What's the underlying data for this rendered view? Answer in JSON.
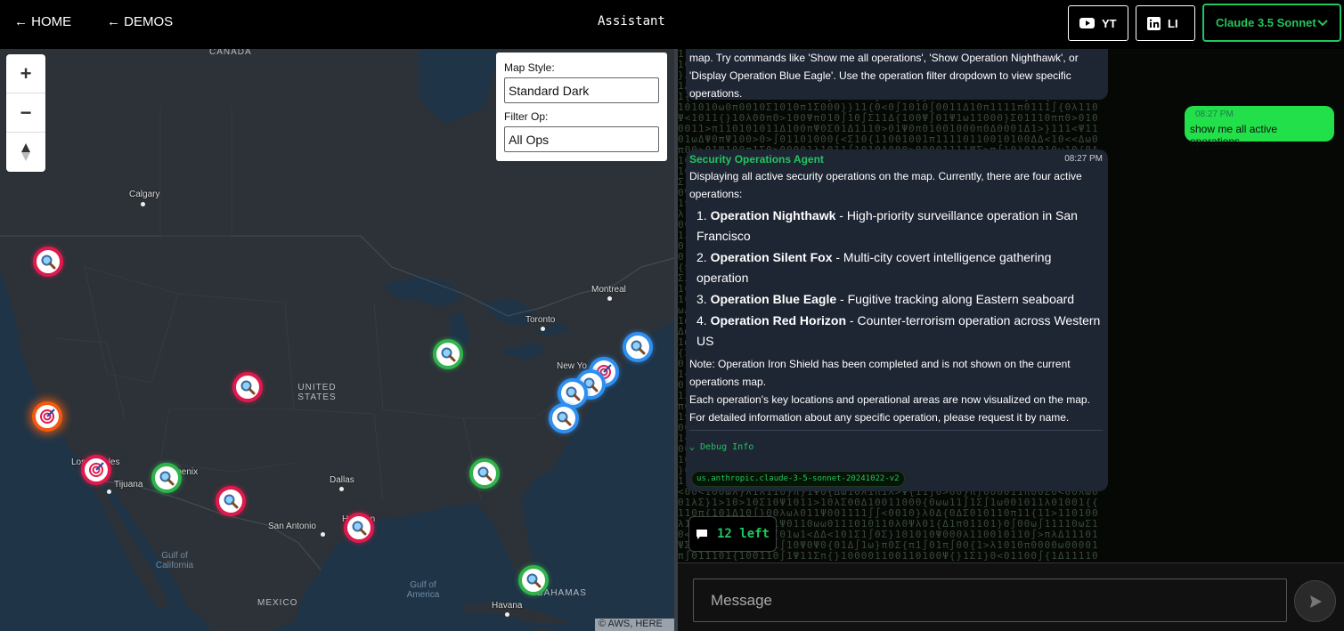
{
  "nav": {
    "home": "← HOME",
    "demos": "← DEMOS",
    "title": "Assistant"
  },
  "social": {
    "yt": "YT",
    "li": "LI"
  },
  "model_select": {
    "value": "Claude 3.5 Sonnet"
  },
  "map": {
    "zoom_in": "+",
    "zoom_out": "−",
    "compass": "▲",
    "style_label": "Map Style:",
    "style_value": "Standard Dark",
    "filter_label": "Filter Op:",
    "filter_value": "All Ops",
    "attribution": "© AWS, HERE",
    "labels": {
      "canada": "CANADA",
      "calgary": "Calgary",
      "montreal": "Montreal",
      "toronto": "Toronto",
      "new_york": "New Yo",
      "us": "UNITED STATES",
      "los_angeles": "Los Angeles",
      "tijuana": "Tijuana",
      "phoenix": "Phoenix",
      "dallas": "Dallas",
      "san_antonio": "San Antonio",
      "houston": "Houston",
      "gulf_ca": "Gulf of California",
      "gulf_mx": "Gulf of America",
      "mexico": "MEXICO",
      "havana": "Havana",
      "bahamas": "BAHAMAS"
    }
  },
  "chat": {
    "top_message": "map. Try commands like 'Show me all operations', 'Show Operation Nighthawk', or 'Display Operation Blue Eagle'. Use the operation filter dropdown to view specific operations.",
    "user_time": "08:27 PM",
    "user_text": "show me all active operations",
    "agent_name": "Security Operations Agent",
    "agent_time": "08:27 PM",
    "intro": "Displaying all active security operations on the map. Currently, there are four active operations:",
    "ops": [
      {
        "num": "1.",
        "name": "Operation Nighthawk",
        "desc": " - High-priority surveillance operation in San Francisco"
      },
      {
        "num": "2.",
        "name": "Operation Silent Fox",
        "desc": " - Multi-city covert intelligence gathering operation"
      },
      {
        "num": "3.",
        "name": "Operation Blue Eagle",
        "desc": " - Fugitive tracking along Eastern seaboard"
      },
      {
        "num": "4.",
        "name": "Operation Red Horizon",
        "desc": " - Counter-terrorism operation across Western US"
      }
    ],
    "note": "Note: Operation Iron Shield has been completed and is not shown on the current operations map.",
    "closing": "Each operation's key locations and operational areas are now visualized on the map. For detailed information about any specific operation, please request it by name.",
    "debug": "⌄ Debug Info",
    "model_id": "us.anthropic.claude-3-5-sonnet-20241022-v2",
    "remaining": "12 left"
  },
  "input": {
    "placeholder": "Message"
  },
  "icons": {
    "marker": "magnifier-icon",
    "target": "target-icon",
    "send": "send-icon",
    "chat": "chat-bubble-icon"
  },
  "colors": {
    "accent": "#22c55e",
    "red_op": "#e0194d",
    "green_op": "#2fb34a",
    "blue_op": "#2f8ff0",
    "orange_op": "#f05a10"
  }
}
